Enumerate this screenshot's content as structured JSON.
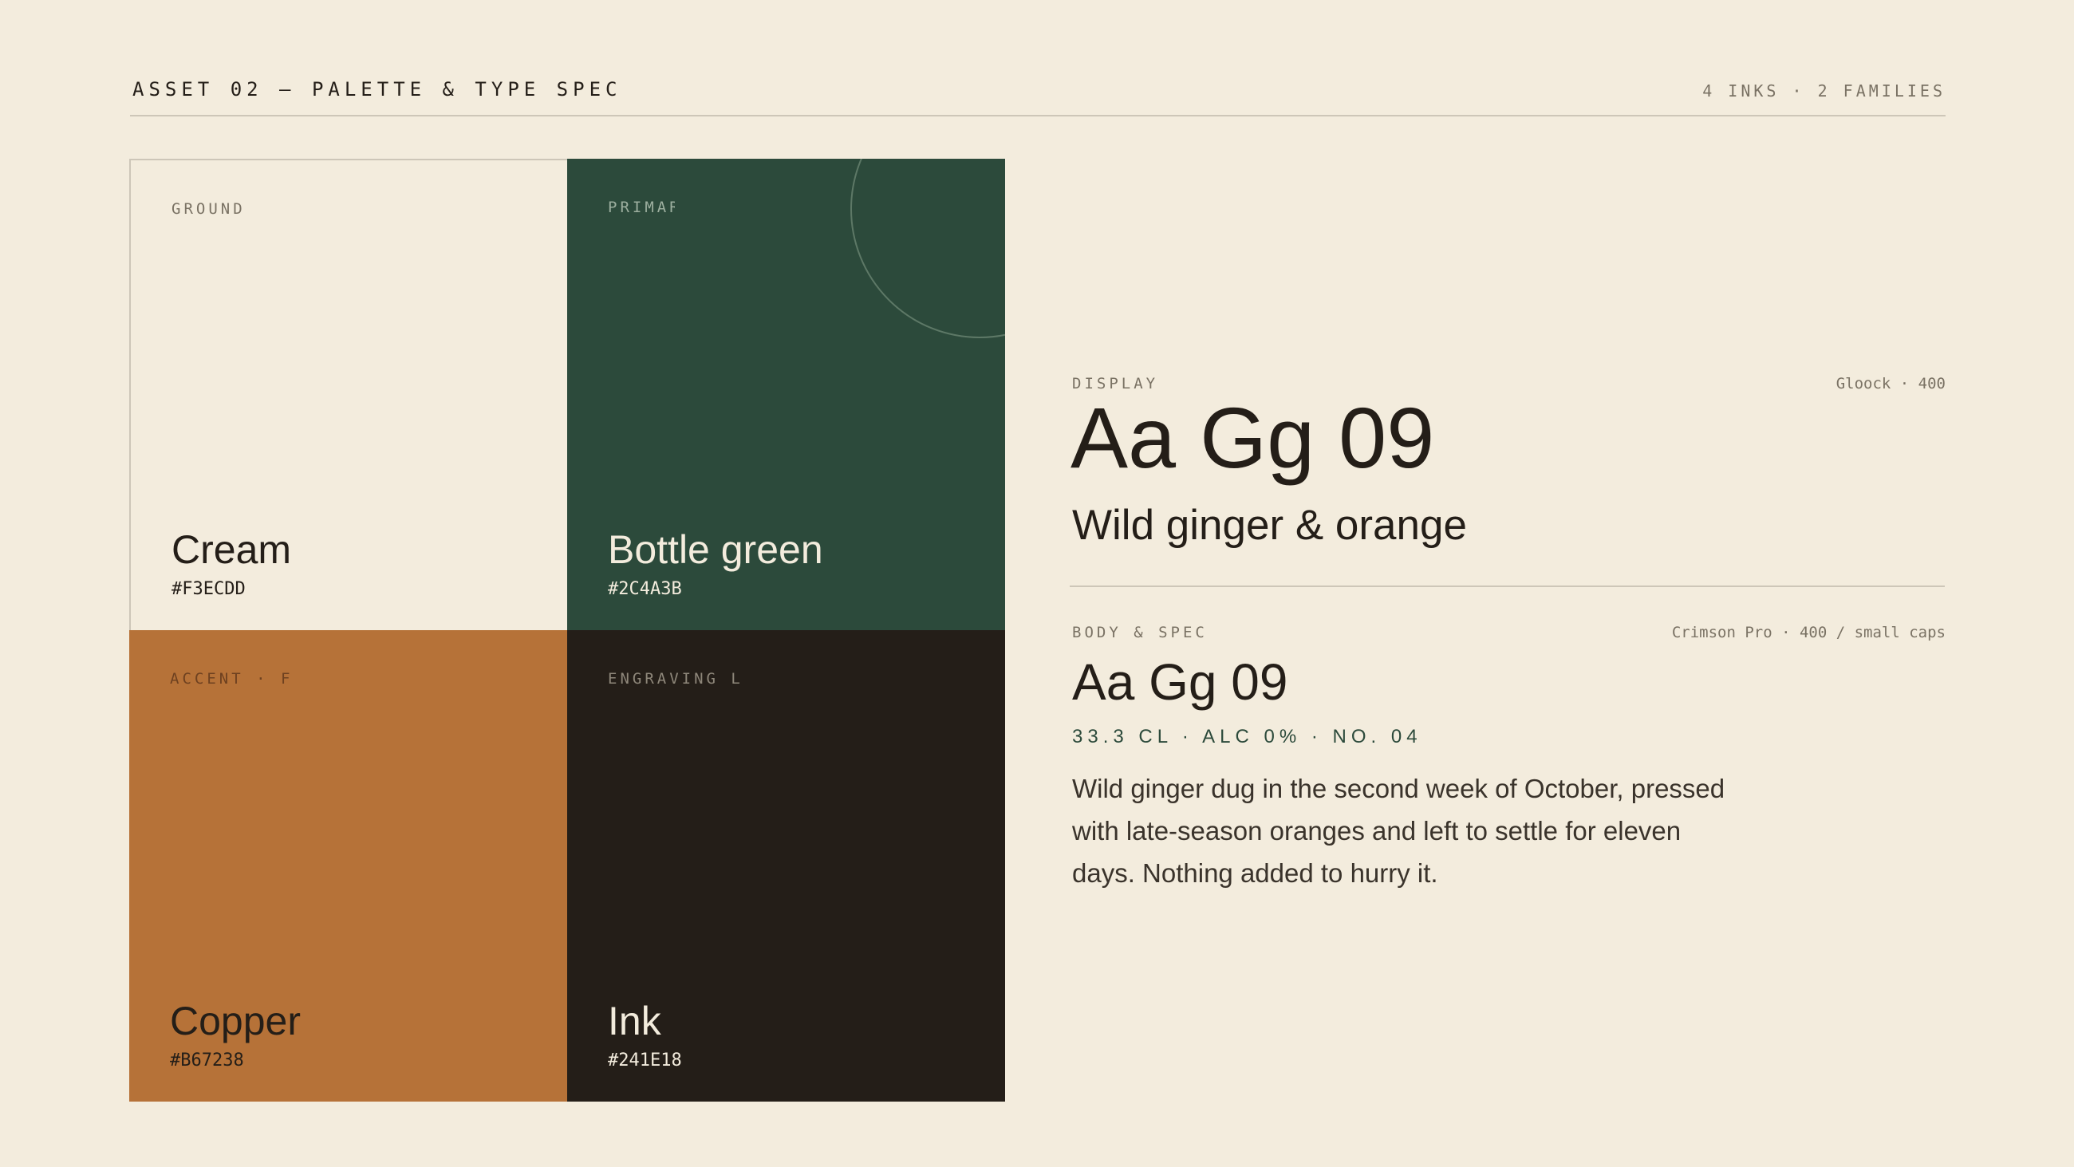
{
  "header": {
    "title": "ASSET 02 — PALETTE & TYPE SPEC",
    "meta": "4 INKS · 2 FAMILIES"
  },
  "swatches": [
    {
      "role": "GROUND",
      "name": "Cream",
      "hex": "#F3ECDD",
      "color": "#F3ECDD",
      "text_color": "#241E18",
      "role_color": "#7A7264"
    },
    {
      "role": "PRIMAR",
      "name": "Bottle green",
      "hex": "#2C4A3B",
      "color": "#2C4A3B",
      "text_color": "#F3ECDD",
      "role_color": "#9DAF9F"
    },
    {
      "role": "ACCENT · F",
      "name": "Copper",
      "hex": "#B67238",
      "color": "#B67238",
      "text_color": "#241E18",
      "role_color": "#6E4120"
    },
    {
      "role": "ENGRAVING L",
      "name": "Ink",
      "hex": "#241E18",
      "color": "#241E18",
      "text_color": "#F3ECDD",
      "role_color": "#8E877A"
    }
  ],
  "display": {
    "label": "DISPLAY",
    "font": "Gloock · 400",
    "specimen": "Aa Gg 09",
    "sample": "Wild ginger & orange"
  },
  "body": {
    "label": "BODY & SPEC",
    "font": "Crimson Pro · 400 / small caps",
    "specimen": "Aa Gg 09",
    "smallcaps": "33.3 CL · ALC 0% · NO. 04",
    "paragraph": "Wild ginger dug in the second week of October, pressed with late-season oranges and left to settle for eleven days. Nothing added to hurry it."
  },
  "colors": {
    "background": "#F3ECDD",
    "rule": "#CDC6B8",
    "muted": "#7A7264"
  }
}
